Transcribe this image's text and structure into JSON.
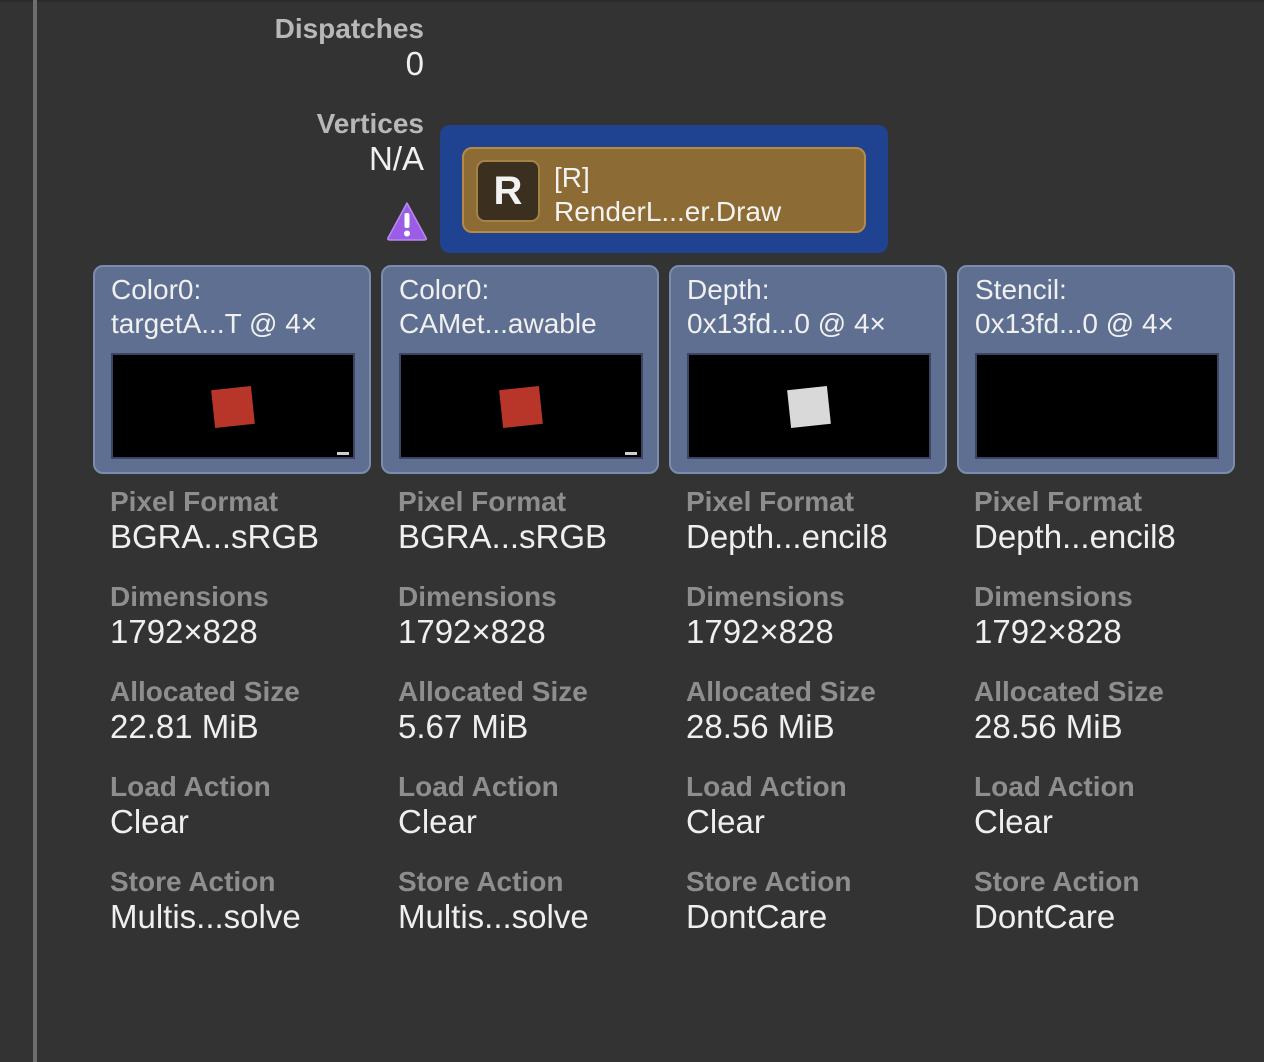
{
  "stats": {
    "dispatches": {
      "label": "Dispatches",
      "value": "0"
    },
    "vertices": {
      "label": "Vertices",
      "value": "N/A"
    }
  },
  "warning_icon": "warning-triangle-icon",
  "encoder": {
    "icon_letter": "R",
    "tag": "[R]",
    "name": "RenderL...er.Draw",
    "colors": {
      "encoder_bg": "#1f4391",
      "chip_bg": "#8c6b34"
    }
  },
  "property_labels": {
    "pixel_format": "Pixel Format",
    "dimensions": "Dimensions",
    "allocated_size": "Allocated Size",
    "load_action": "Load Action",
    "store_action": "Store Action"
  },
  "attachments": [
    {
      "title_line1": "Color0:",
      "title_line2": "targetA...T @ 4×",
      "square_color": "#b8352a",
      "pixel_format": "BGRA...sRGB",
      "dimensions": "1792×828",
      "allocated_size": "22.81 MiB",
      "load_action": "Clear",
      "store_action": "Multis...solve"
    },
    {
      "title_line1": "Color0:",
      "title_line2": "CAMet...awable",
      "square_color": "#b8352a",
      "pixel_format": "BGRA...sRGB",
      "dimensions": "1792×828",
      "allocated_size": "5.67 MiB",
      "load_action": "Clear",
      "store_action": "Multis...solve"
    },
    {
      "title_line1": "Depth:",
      "title_line2": "0x13fd...0 @ 4×",
      "square_color": "#d9d9d9",
      "pixel_format": "Depth...encil8",
      "dimensions": "1792×828",
      "allocated_size": "28.56 MiB",
      "load_action": "Clear",
      "store_action": "DontCare"
    },
    {
      "title_line1": "Stencil:",
      "title_line2": "0x13fd...0 @ 4×",
      "square_color": null,
      "pixel_format": "Depth...encil8",
      "dimensions": "1792×828",
      "allocated_size": "28.56 MiB",
      "load_action": "Clear",
      "store_action": "DontCare"
    }
  ]
}
